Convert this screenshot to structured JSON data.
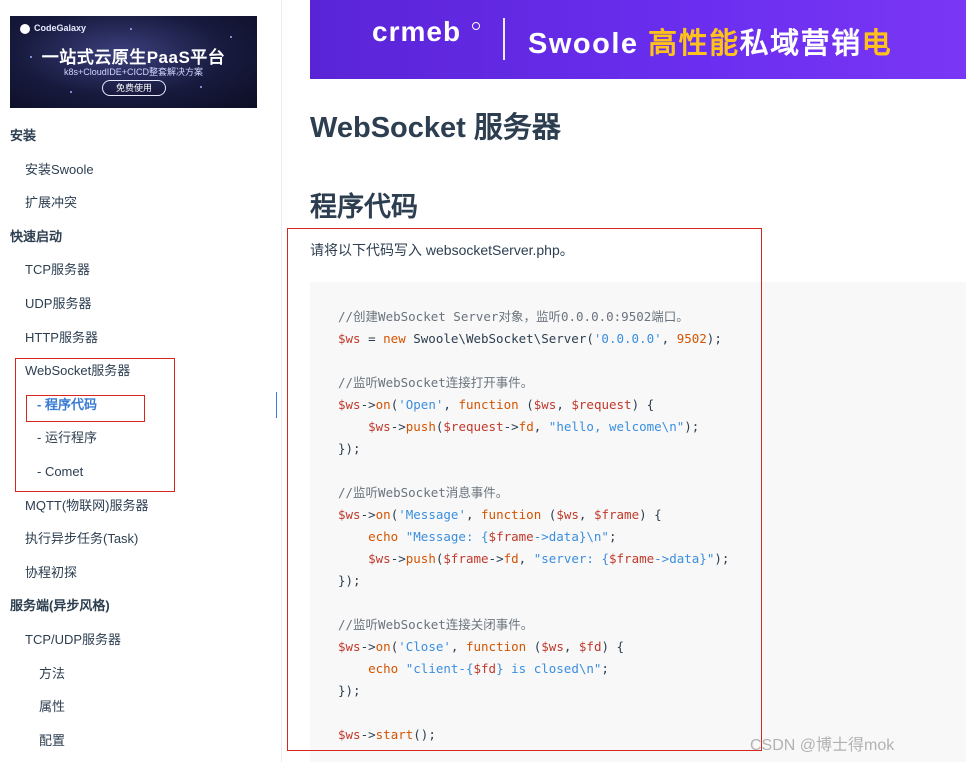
{
  "ad": {
    "brand": "CodeGalaxy",
    "title": "一站式云原生PaaS平台",
    "subtitle": "k8s+CloudIDE+CICD整套解决方案",
    "button": "免费使用"
  },
  "sidebar": {
    "items": [
      {
        "label": "安装",
        "level": 0
      },
      {
        "label": "安装Swoole",
        "level": 1
      },
      {
        "label": "扩展冲突",
        "level": 1
      },
      {
        "label": "快速启动",
        "level": 0
      },
      {
        "label": "TCP服务器",
        "level": 1
      },
      {
        "label": "UDP服务器",
        "level": 1
      },
      {
        "label": "HTTP服务器",
        "level": 1
      },
      {
        "label": "WebSocket服务器",
        "level": 1
      },
      {
        "label": "- 程序代码",
        "level": 2,
        "active": true
      },
      {
        "label": "- 运行程序",
        "level": 2
      },
      {
        "label": "- Comet",
        "level": 2
      },
      {
        "label": "MQTT(物联网)服务器",
        "level": 1
      },
      {
        "label": "执行异步任务(Task)",
        "level": 1
      },
      {
        "label": "协程初探",
        "level": 1
      },
      {
        "label": "服务端(异步风格)",
        "level": 0
      },
      {
        "label": "TCP/UDP服务器",
        "level": 1
      },
      {
        "label": "方法",
        "level": 3
      },
      {
        "label": "属性",
        "level": 3
      },
      {
        "label": "配置",
        "level": 3
      }
    ]
  },
  "banner": {
    "logo": "crmeb",
    "text_white": "Swoole ",
    "text_highlight": "高性能",
    "text_white2": "私域营销",
    "text_highlight2": "电"
  },
  "content": {
    "title": "WebSocket 服务器",
    "section": "程序代码",
    "intro": "请将以下代码写入 websocketServer.php。"
  },
  "code_lines": [
    [
      [
        "c-com",
        "//创建WebSocket Server对象，监听0.0.0.0:9502端口。"
      ]
    ],
    [
      [
        "c-var",
        "$ws"
      ],
      [
        "c-plain",
        " = "
      ],
      [
        "c-kw",
        "new"
      ],
      [
        "c-plain",
        " Swoole\\WebSocket\\Server("
      ],
      [
        "c-str",
        "'0.0.0.0'"
      ],
      [
        "c-plain",
        ", "
      ],
      [
        "c-num",
        "9502"
      ],
      [
        "c-plain",
        ");"
      ]
    ],
    [],
    [
      [
        "c-com",
        "//监听WebSocket连接打开事件。"
      ]
    ],
    [
      [
        "c-var",
        "$ws"
      ],
      [
        "c-plain",
        "->"
      ],
      [
        "c-kw",
        "on"
      ],
      [
        "c-plain",
        "("
      ],
      [
        "c-str",
        "'Open'"
      ],
      [
        "c-plain",
        ", "
      ],
      [
        "c-kw",
        "function"
      ],
      [
        "c-plain",
        " ("
      ],
      [
        "c-var",
        "$ws"
      ],
      [
        "c-plain",
        ", "
      ],
      [
        "c-var",
        "$request"
      ],
      [
        "c-plain",
        ") {"
      ]
    ],
    [
      [
        "c-plain",
        "    "
      ],
      [
        "c-var",
        "$ws"
      ],
      [
        "c-plain",
        "->"
      ],
      [
        "c-kw",
        "push"
      ],
      [
        "c-plain",
        "("
      ],
      [
        "c-var",
        "$request"
      ],
      [
        "c-plain",
        "->"
      ],
      [
        "c-kw",
        "fd"
      ],
      [
        "c-plain",
        ", "
      ],
      [
        "c-str",
        "\"hello, welcome\\n\""
      ],
      [
        "c-plain",
        ");"
      ]
    ],
    [
      [
        "c-plain",
        "});"
      ]
    ],
    [],
    [
      [
        "c-com",
        "//监听WebSocket消息事件。"
      ]
    ],
    [
      [
        "c-var",
        "$ws"
      ],
      [
        "c-plain",
        "->"
      ],
      [
        "c-kw",
        "on"
      ],
      [
        "c-plain",
        "("
      ],
      [
        "c-str",
        "'Message'"
      ],
      [
        "c-plain",
        ", "
      ],
      [
        "c-kw",
        "function"
      ],
      [
        "c-plain",
        " ("
      ],
      [
        "c-var",
        "$ws"
      ],
      [
        "c-plain",
        ", "
      ],
      [
        "c-var",
        "$frame"
      ],
      [
        "c-plain",
        ") {"
      ]
    ],
    [
      [
        "c-plain",
        "    "
      ],
      [
        "c-kw",
        "echo"
      ],
      [
        "c-plain",
        " "
      ],
      [
        "c-str",
        "\"Message: {"
      ],
      [
        "c-var",
        "$frame"
      ],
      [
        "c-str",
        "->data}\\n\""
      ],
      [
        "c-plain",
        ";"
      ]
    ],
    [
      [
        "c-plain",
        "    "
      ],
      [
        "c-var",
        "$ws"
      ],
      [
        "c-plain",
        "->"
      ],
      [
        "c-kw",
        "push"
      ],
      [
        "c-plain",
        "("
      ],
      [
        "c-var",
        "$frame"
      ],
      [
        "c-plain",
        "->"
      ],
      [
        "c-kw",
        "fd"
      ],
      [
        "c-plain",
        ", "
      ],
      [
        "c-str",
        "\"server: {"
      ],
      [
        "c-var",
        "$frame"
      ],
      [
        "c-str",
        "->data}\""
      ],
      [
        "c-plain",
        ");"
      ]
    ],
    [
      [
        "c-plain",
        "});"
      ]
    ],
    [],
    [
      [
        "c-com",
        "//监听WebSocket连接关闭事件。"
      ]
    ],
    [
      [
        "c-var",
        "$ws"
      ],
      [
        "c-plain",
        "->"
      ],
      [
        "c-kw",
        "on"
      ],
      [
        "c-plain",
        "("
      ],
      [
        "c-str",
        "'Close'"
      ],
      [
        "c-plain",
        ", "
      ],
      [
        "c-kw",
        "function"
      ],
      [
        "c-plain",
        " ("
      ],
      [
        "c-var",
        "$ws"
      ],
      [
        "c-plain",
        ", "
      ],
      [
        "c-var",
        "$fd"
      ],
      [
        "c-plain",
        ") {"
      ]
    ],
    [
      [
        "c-plain",
        "    "
      ],
      [
        "c-kw",
        "echo"
      ],
      [
        "c-plain",
        " "
      ],
      [
        "c-str",
        "\"client-{"
      ],
      [
        "c-var",
        "$fd"
      ],
      [
        "c-str",
        "} is closed\\n\""
      ],
      [
        "c-plain",
        ";"
      ]
    ],
    [
      [
        "c-plain",
        "});"
      ]
    ],
    [],
    [
      [
        "c-var",
        "$ws"
      ],
      [
        "c-plain",
        "->"
      ],
      [
        "c-kw",
        "start"
      ],
      [
        "c-plain",
        "();"
      ]
    ]
  ],
  "watermark": "CSDN @博士得mok"
}
